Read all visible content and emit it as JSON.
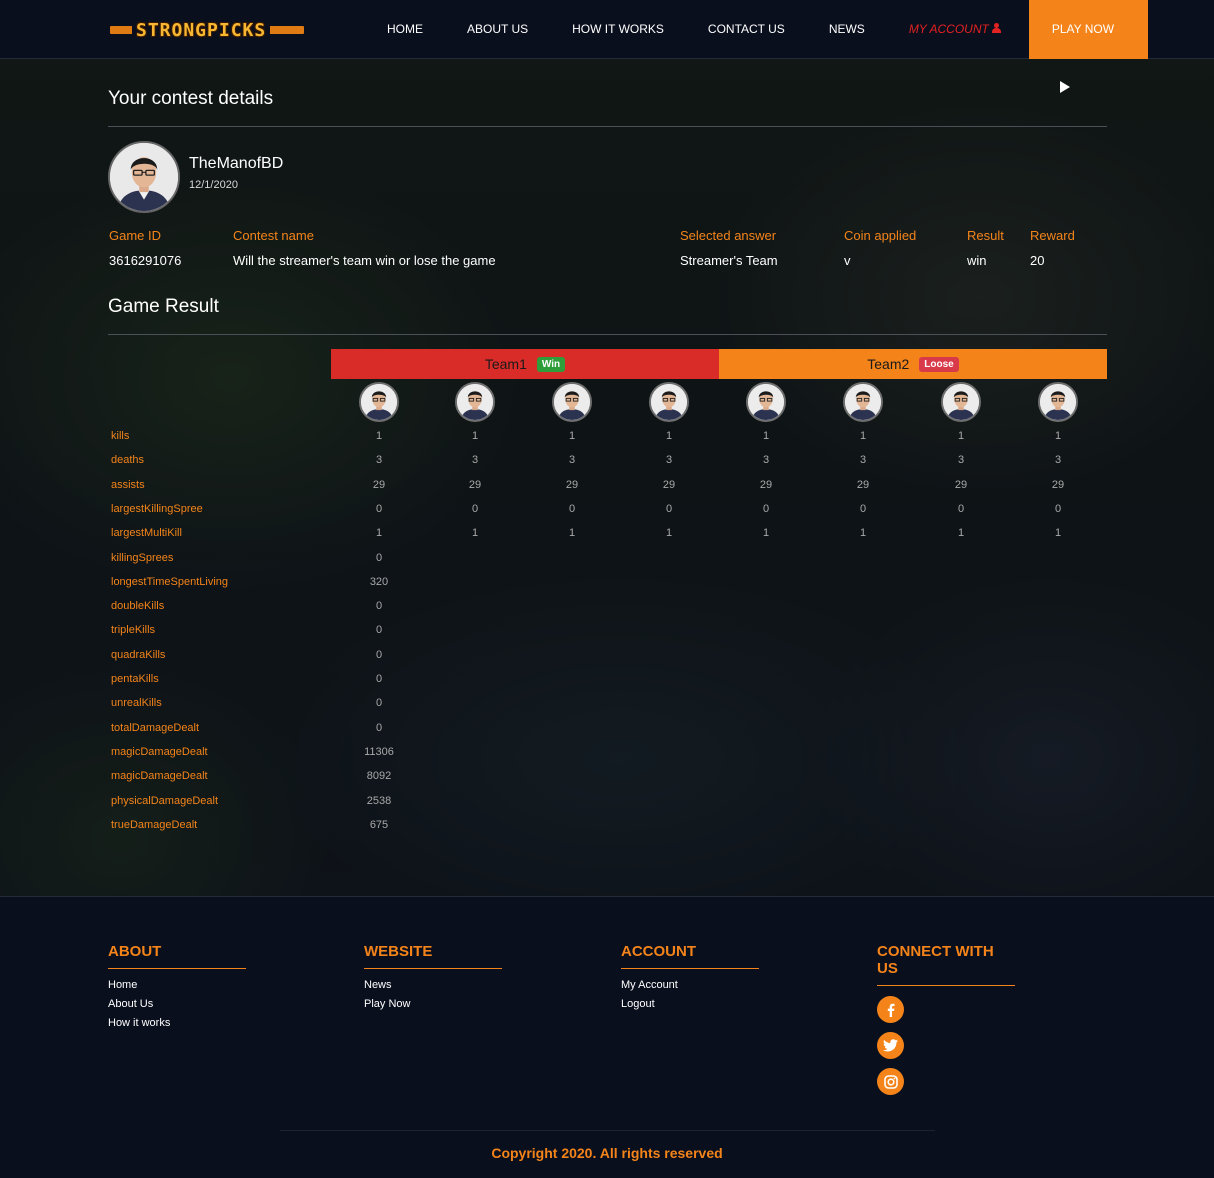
{
  "brand": {
    "logo_text": "STRONGPICKS"
  },
  "nav": {
    "items": [
      "HOME",
      "ABOUT US",
      "HOW IT WORKS",
      "CONTACT US",
      "NEWS"
    ],
    "account": "MY ACCOUNT",
    "play": "PLAY NOW"
  },
  "contest": {
    "title": "Your contest details",
    "username": "TheManofBD",
    "date": "12/1/2020",
    "columns": [
      {
        "label": "Game ID",
        "value": "3616291076"
      },
      {
        "label": "Contest name",
        "value": "Will the streamer's team win or lose the game"
      },
      {
        "label": "Selected answer",
        "value": "Streamer's Team"
      },
      {
        "label": "Coin applied",
        "value": "v"
      },
      {
        "label": "Result",
        "value": "win"
      },
      {
        "label": "Reward",
        "value": "20"
      }
    ]
  },
  "game_result": {
    "title": "Game Result",
    "team1": {
      "name": "Team1",
      "badge": "Win"
    },
    "team2": {
      "name": "Team2",
      "badge": "Loose"
    },
    "stats": [
      {
        "label": "kills",
        "values": [
          "1",
          "1",
          "1",
          "1",
          "1",
          "1",
          "1",
          "1"
        ]
      },
      {
        "label": "deaths",
        "values": [
          "3",
          "3",
          "3",
          "3",
          "3",
          "3",
          "3",
          "3"
        ]
      },
      {
        "label": "assists",
        "values": [
          "29",
          "29",
          "29",
          "29",
          "29",
          "29",
          "29",
          "29"
        ]
      },
      {
        "label": "largestKillingSpree",
        "values": [
          "0",
          "0",
          "0",
          "0",
          "0",
          "0",
          "0",
          "0"
        ]
      },
      {
        "label": "largestMultiKill",
        "values": [
          "1",
          "1",
          "1",
          "1",
          "1",
          "1",
          "1",
          "1"
        ]
      },
      {
        "label": "killingSprees",
        "values": [
          "0"
        ]
      },
      {
        "label": "longestTimeSpentLiving",
        "values": [
          "320"
        ]
      },
      {
        "label": "doubleKills",
        "values": [
          "0"
        ]
      },
      {
        "label": "tripleKills",
        "values": [
          "0"
        ]
      },
      {
        "label": "quadraKills",
        "values": [
          "0"
        ]
      },
      {
        "label": "pentaKills",
        "values": [
          "0"
        ]
      },
      {
        "label": "unrealKills",
        "values": [
          "0"
        ]
      },
      {
        "label": "totalDamageDealt",
        "values": [
          "0"
        ]
      },
      {
        "label": "magicDamageDealt",
        "values": [
          "11306"
        ]
      },
      {
        "label": "magicDamageDealt",
        "values": [
          "8092"
        ]
      },
      {
        "label": "physicalDamageDealt",
        "values": [
          "2538"
        ]
      },
      {
        "label": "trueDamageDealt",
        "values": [
          "675"
        ]
      }
    ]
  },
  "footer": {
    "about": {
      "title": "ABOUT",
      "links": [
        "Home",
        "About Us",
        "How it works"
      ]
    },
    "website": {
      "title": "WEBSITE",
      "links": [
        "News",
        "Play Now"
      ]
    },
    "account": {
      "title": "ACCOUNT",
      "links": [
        "My Account",
        "Logout"
      ]
    },
    "connect": {
      "title": "CONNECT WITH US",
      "icons": [
        "facebook-icon",
        "twitter-icon",
        "instagram-icon"
      ]
    },
    "copyright": "Copyright 2020. All rights reserved"
  },
  "colors": {
    "accent": "#f4841a",
    "team1": "#d92b28",
    "team2": "#f4841a",
    "win": "#2e9e3a",
    "lose": "#d83a4a"
  }
}
